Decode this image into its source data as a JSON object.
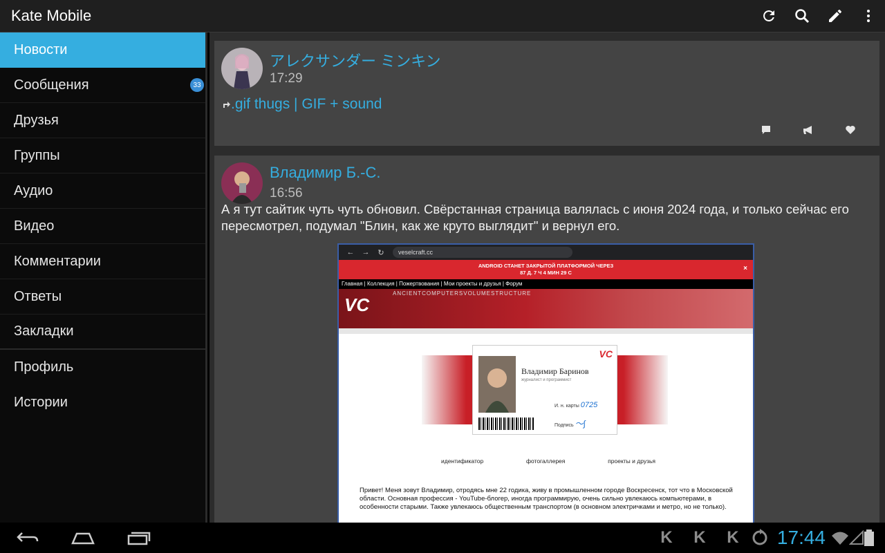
{
  "app": {
    "title": "Kate Mobile"
  },
  "actions": [
    "refresh-icon",
    "search-icon",
    "edit-icon",
    "overflow-menu-icon"
  ],
  "sidebar": {
    "items": [
      {
        "label": "Новости",
        "active": true
      },
      {
        "label": "Сообщения",
        "badge": "33"
      },
      {
        "label": "Друзья"
      },
      {
        "label": "Группы"
      },
      {
        "label": "Аудио"
      },
      {
        "label": "Видео"
      },
      {
        "label": "Комментарии"
      },
      {
        "label": "Ответы"
      },
      {
        "label": "Закладки"
      },
      {
        "label": "Профиль"
      },
      {
        "label": "Истории"
      }
    ]
  },
  "feed": {
    "posts": [
      {
        "author": "アレクサンダー ミンキン",
        "time": "17:29",
        "link_text": ".gif thugs | GIF + sound"
      },
      {
        "author": "Владимир Б.-С.",
        "time": "16:56",
        "text": "А я тут сайтик чуть чуть обновил. Свёрстанная страница валялась с июня 2024 года, и только сейчас его пересмотрел,  подумал \"Блин, как же круто выглядит\" и вернул его.",
        "screenshot": {
          "url": "veselcraft.cc",
          "banner_line1": "ANDROID СТАНЕТ ЗАКРЫТОЙ ПЛАТФОРМОЙ ЧЕРЕЗ",
          "banner_line2": "87 Д. 7 Ч 4 МИН 29 С",
          "nav": "Главная | Коллекция | Пожертвования | Мои проекты и друзья | Форум",
          "logo": "VC",
          "tag": "ANCIENTCOMPUTERSVOLUMESTRUCTURE",
          "card_name": "Владимир Баринов",
          "card_role": "журналист и программист",
          "card_no_label": "И. н. карты",
          "card_no": "0725",
          "card_sign_label": "Подпись",
          "links": [
            "идентификатор",
            "фотогаллерея",
            "проекты и друзья"
          ],
          "bio": "Привет! Меня зовут Владимир, отродясь мне 22 годика, живу в промышленном городе Воскресенск, тот что в Московской области. Основная профессия - YouTube-блогер, иногда программирую, очень сильно увлекаюсь компьютерами, в особенности старыми. Также увлекаюсь общественным транспортом (в основном электричками и метро, но не только)."
        }
      }
    ]
  },
  "status": {
    "time": "17:44"
  },
  "colors": {
    "accent": "#35aee0",
    "card_bg": "#444444",
    "feed_bg": "#2c2c2c"
  }
}
